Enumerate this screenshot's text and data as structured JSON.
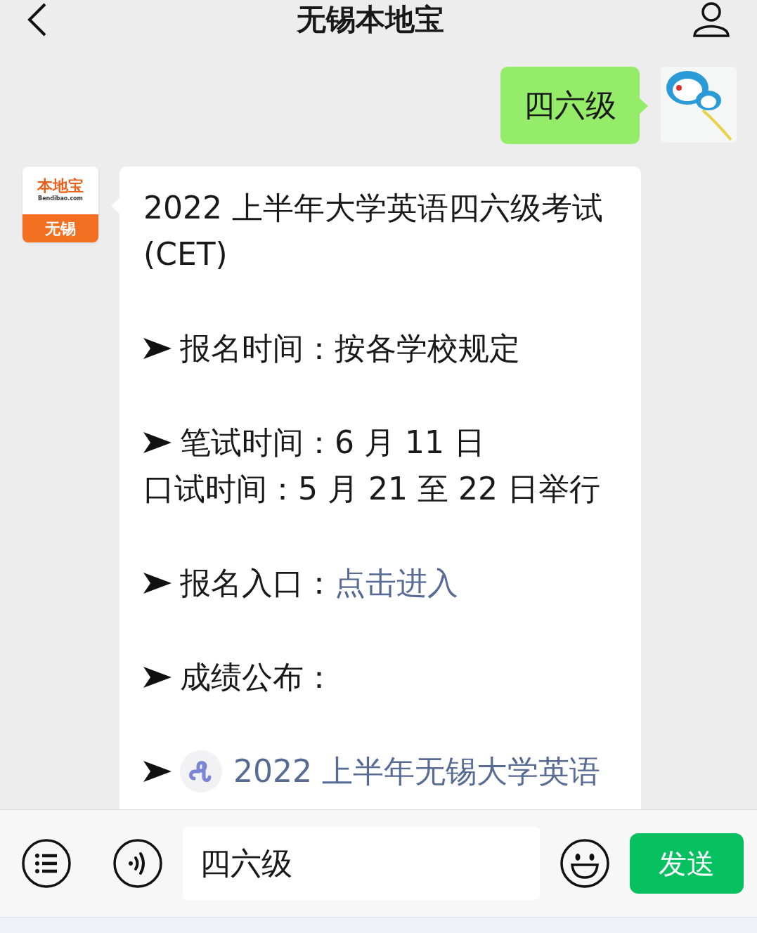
{
  "header": {
    "title": "无锡本地宝"
  },
  "messages": [
    {
      "kind": "sent",
      "text": "四六级"
    },
    {
      "kind": "received",
      "avatar": {
        "logo": "本地宝",
        "domain": "Bendibao.com",
        "city": "无锡"
      },
      "items": [
        {
          "kind": "title",
          "text": "2022 上半年大学英语四六级考试(CET)"
        },
        {
          "kind": "bullet",
          "text": "报名时间：按各学校规定"
        },
        {
          "kind": "bullet",
          "text": "笔试时间：6 月 11 日",
          "extra": "口试时间：5 月 21 至 22 日举行"
        },
        {
          "kind": "bullet",
          "text": "报名入口：",
          "link": "点击进入"
        },
        {
          "kind": "bullet",
          "text": "成绩公布："
        },
        {
          "kind": "mini_program",
          "link": "2022 上半年无锡大学英语"
        }
      ]
    }
  ],
  "input_bar": {
    "value": "四六级",
    "send": "发送"
  }
}
